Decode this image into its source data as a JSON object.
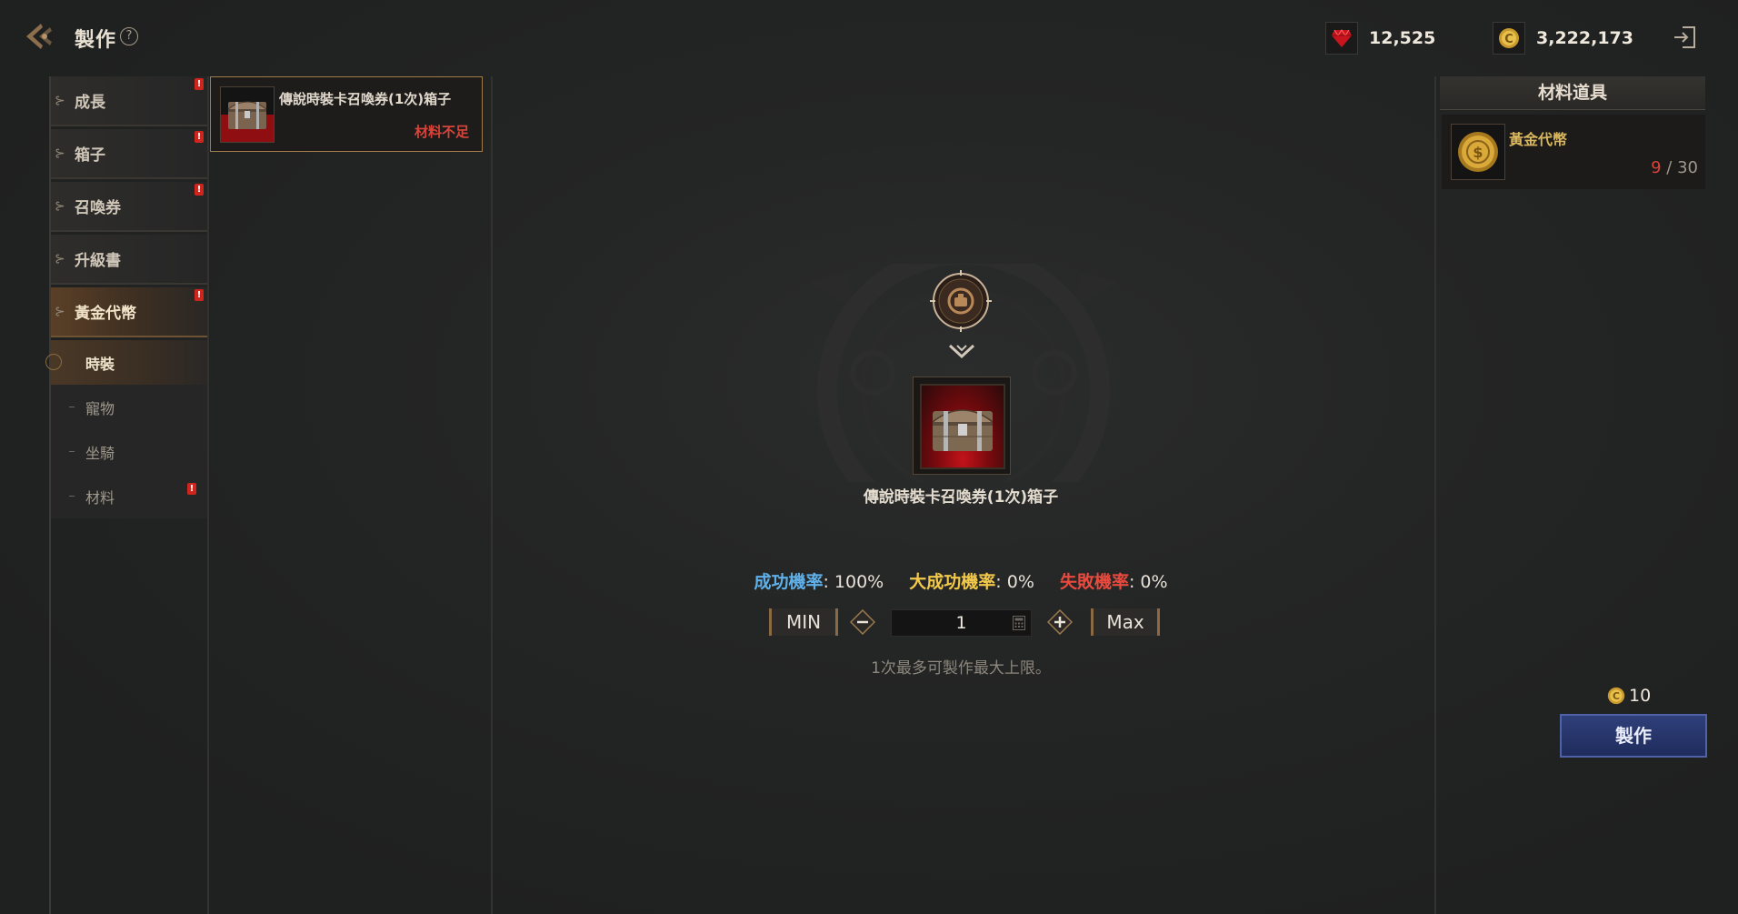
{
  "header": {
    "title": "製作",
    "help_icon": "question-icon",
    "currencies": [
      {
        "icon": "red-gem-icon",
        "value": "12,525"
      },
      {
        "icon": "gold-coin-icon",
        "value": "3,222,173"
      }
    ],
    "exit_icon": "exit-icon"
  },
  "sidebar": {
    "categories": [
      {
        "label": "成長",
        "badge": "!"
      },
      {
        "label": "箱子",
        "badge": "!"
      },
      {
        "label": "召喚券",
        "badge": "!"
      },
      {
        "label": "升級書",
        "badge": ""
      },
      {
        "label": "黃金代幣",
        "badge": "!"
      }
    ],
    "subcategories": [
      {
        "label": "時裝",
        "badge": ""
      },
      {
        "label": "寵物",
        "badge": ""
      },
      {
        "label": "坐騎",
        "badge": ""
      },
      {
        "label": "材料",
        "badge": "!"
      }
    ]
  },
  "recipes": [
    {
      "name": "傳說時裝卡召喚券(1次)箱子",
      "status": "材料不足"
    }
  ],
  "detail": {
    "item_name": "傳說時裝卡召喚券(1次)箱子",
    "success_label": "成功機率",
    "success_value": ": 100%",
    "great_label": "大成功機率",
    "great_value": ": 0%",
    "fail_label": "失敗機率",
    "fail_value": ": 0%",
    "min_label": "MIN",
    "max_label": "Max",
    "quantity": "1",
    "limit_note": "1次最多可製作最大上限。"
  },
  "materials": {
    "header": "材料道具",
    "items": [
      {
        "name": "黃金代幣",
        "have": "9",
        "separator": " / ",
        "need": "30"
      }
    ]
  },
  "craft": {
    "cost": "10",
    "button_label": "製作"
  },
  "colors": {
    "accent_gold": "#a07c4a",
    "success": "#5fb0e8",
    "great_success": "#f2c94a",
    "fail": "#e84a3e",
    "craft_button": "#2f3f7a"
  }
}
